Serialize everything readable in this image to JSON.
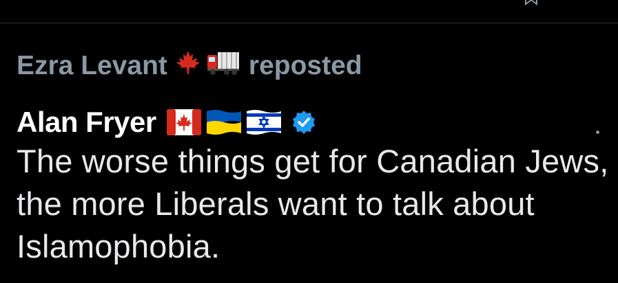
{
  "repost": {
    "reposter_name": "Ezra Levant",
    "reposter_emoji": [
      "maple-leaf-icon",
      "truck-icon"
    ],
    "action_label": "reposted"
  },
  "post": {
    "author_name": "Alan Fryer",
    "author_flags": [
      "canada-flag-icon",
      "ukraine-flag-icon",
      "israel-flag-icon"
    ],
    "verified": true,
    "body": "The worse things get for Canadian Jews, the more Liberals want to talk about Islamophobia."
  },
  "colors": {
    "background": "#000000",
    "muted_text": "#8b98a5",
    "primary_text": "#e7e9ea",
    "verified_blue": "#1d9bf0",
    "divider": "#2f3336"
  }
}
